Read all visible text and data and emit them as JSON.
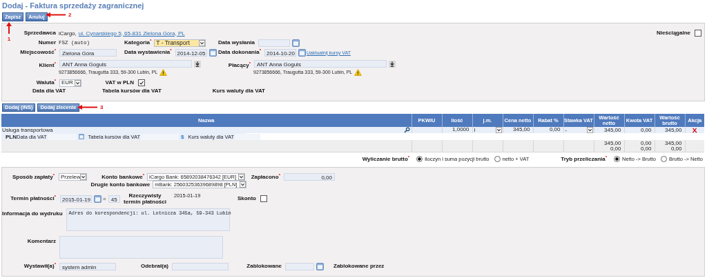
{
  "title": "Dodaj - Faktura sprzedaży zagranicznej",
  "toolbar": [
    {
      "label": "Zapisz"
    },
    {
      "label": "Anuluj"
    }
  ],
  "annotations": [
    {
      "kind": "up",
      "number": "1"
    },
    {
      "kind": "left",
      "number": "2"
    },
    {
      "kind": "left",
      "number": "3"
    }
  ],
  "header": {
    "seller": {
      "label": "Sprzedawca",
      "name": "iCargo,",
      "address_link": "ul. Cynarskiego 5, 65-831 Zielona Góra, PL"
    },
    "uncollectible": {
      "label": "Nieściągalne",
      "checked": false
    },
    "number": {
      "label": "Numer",
      "value": "FSZ (auto)"
    },
    "category": {
      "label": "Kategoria$^{*}$",
      "value": "T - Transport"
    },
    "ship_date": {
      "label": "Data wysłania"
    },
    "place": {
      "label": "Miejscowość$^{*}$",
      "value": "Zielona Góra"
    },
    "issue_date": {
      "label": "Data wystawienia$^{*}$",
      "value": "2014-12-05"
    },
    "completion_date": {
      "label": "Data dokonania$^{*}$",
      "value": "2014-10-20",
      "link": "Uaktualnij kursy VAT"
    },
    "client": {
      "label": "Klient$^{*}$",
      "value": "ANT Anna Goguls",
      "details": "9273856666, Traugutta 333, 59-300 Lubin, PL"
    },
    "payer": {
      "label": "Płacący$^{*}$",
      "value": "ANT Anna Goguls",
      "details": "9273856666, Traugutta 333, 59-300 Lubin, PL"
    },
    "currency": {
      "label": "Waluta$^{*}$",
      "value": "EUR"
    },
    "vat_in_pln": {
      "label": "VAT w PLN",
      "checked": true
    },
    "vat_labels": [
      "Data dla VAT",
      "Tabela kursów dla VAT",
      "Kurs waluty dla VAT"
    ]
  },
  "item_buttons": [
    {
      "label": "Dodaj (INS)"
    },
    {
      "label": "Dodaj zlecenie"
    }
  ],
  "table": {
    "columns": [
      "Nazwa",
      "PKWiU",
      "Ilość",
      "j.m.",
      "Cena netto",
      "Rabat %",
      "Stawka VAT",
      "Wartość netto",
      "Kwota VAT",
      "Wartość brutto",
      "Akcja"
    ],
    "rows": [
      {
        "name": "Usługa transportowa",
        "quantity": "1,0000",
        "unit": "l",
        "net_price": "345,00",
        "discount": "0,00",
        "vat_rate": "-",
        "net_value": "345,00",
        "vat_amount": "0,00",
        "gross_value": "345,00",
        "vat_details": {
          "currency": "PLN",
          "date_label": "Data dla VAT",
          "table_label": "Tabela kursów dla VAT",
          "rate_symbol": "$",
          "rate_label": "Kurs waluty dla VAT"
        }
      }
    ],
    "totals": {
      "net_value": [
        "345,00",
        "0,00"
      ],
      "vat_amount": [
        "0,00",
        "0,00"
      ],
      "gross_value": [
        "345,00",
        "0,00"
      ]
    }
  },
  "gross_calc": {
    "label": "Wyliczanie brutto$^{*}$",
    "options": [
      {
        "label": "iloczyn i suma pozycji brutto",
        "selected": true
      },
      {
        "label": "netto + VAT",
        "selected": false
      }
    ]
  },
  "conversion_mode": {
    "label": "Tryb przeliczania$^{*}$",
    "options": [
      {
        "label": "Netto -> Brutto",
        "selected": true
      },
      {
        "label": "Brutto -> Netto",
        "selected": false
      }
    ]
  },
  "payment": {
    "method": {
      "label": "Sposób zapłaty$^{*}$",
      "value": "Przelew"
    },
    "bank_account": {
      "label": "Konto bankowe$^{*}$",
      "value": "iCargo Bank: 65892038476342 [EUR]"
    },
    "second_account": {
      "label": "Drugie konto bankowe",
      "value": "mBank: 25603253639689898 [PLN]"
    },
    "paid": {
      "label": "Zapłacono$^{*}$",
      "value": "0,00"
    },
    "due_date": {
      "label": "Termin płatności$^{*}$",
      "value": "2015-01-19",
      "separator": "=",
      "days": "45"
    },
    "actual_due": {
      "label": "Rzeczywisty termin płatności",
      "value": "2015-01-19"
    },
    "discount": {
      "label": "Skonto",
      "checked": false
    },
    "print_info": {
      "label": "Informacja do wydruku",
      "value": "Adres do korespondencji: ul. Lotnicza 345a, 59-343 Lubin"
    },
    "comment": {
      "label": "Komentarz"
    },
    "issued_by": {
      "label": "Wystawił(a)$^{*}$",
      "value": "system admin"
    },
    "received_by": {
      "label": "Odebrał(a)"
    },
    "locked": {
      "label": "Zablokowane"
    },
    "locked_by": {
      "label": "Zablokowane przez"
    }
  }
}
